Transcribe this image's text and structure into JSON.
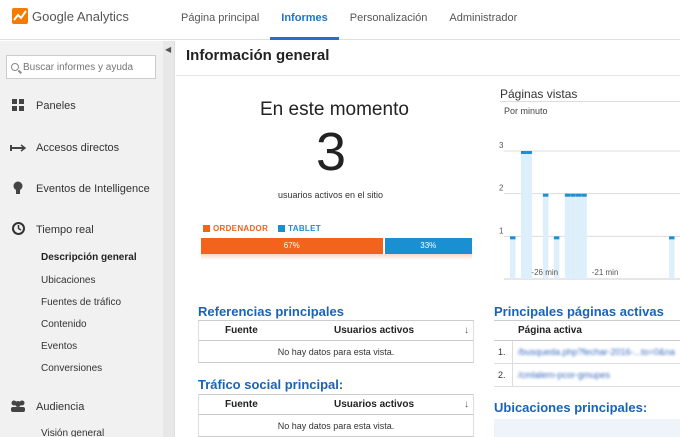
{
  "app": {
    "logo_text": "Google Analytics"
  },
  "topnav": {
    "items": [
      {
        "label": "Página principal"
      },
      {
        "label": "Informes"
      },
      {
        "label": "Personalización"
      },
      {
        "label": "Administrador"
      }
    ]
  },
  "sidebar": {
    "search_placeholder": "Buscar informes y ayuda",
    "items": [
      {
        "label": "Paneles",
        "icon": "grid-icon"
      },
      {
        "label": "Accesos directos",
        "icon": "shortcut-icon"
      },
      {
        "label": "Eventos de Intelligence",
        "icon": "lightbulb-icon"
      },
      {
        "label": "Tiempo real",
        "icon": "clock-icon"
      },
      {
        "label": "Audiencia",
        "icon": "people-icon"
      }
    ],
    "realtime_subitems": [
      {
        "label": "Descripción general"
      },
      {
        "label": "Ubicaciones"
      },
      {
        "label": "Fuentes de tráfico"
      },
      {
        "label": "Contenido"
      },
      {
        "label": "Eventos"
      },
      {
        "label": "Conversiones"
      }
    ],
    "audience_subitems": [
      {
        "label": "Visión general"
      }
    ]
  },
  "main": {
    "title": "Información general",
    "now": {
      "title": "En este momento",
      "count": "3",
      "subtitle": "usuarios activos en el sitio"
    },
    "devices": {
      "legend": [
        {
          "label": "ORDENADOR",
          "color": "#f2631c"
        },
        {
          "label": "TABLET",
          "color": "#1a8fd1"
        }
      ],
      "segments": [
        {
          "label": "67%",
          "value": 67,
          "color": "#f2631c"
        },
        {
          "label": "33%",
          "value": 33,
          "color": "#1a8fd1"
        }
      ]
    },
    "referrals": {
      "title": "Referencias principales",
      "col_source": "Fuente",
      "col_users": "Usuarios activos",
      "empty": "No hay datos para esta vista."
    },
    "social": {
      "title": "Tráfico social principal:",
      "col_source": "Fuente",
      "col_users": "Usuarios activos",
      "empty": "No hay datos para esta vista."
    },
    "top_pages": {
      "title": "Principales páginas activas",
      "col_page": "Página activa",
      "rows": [
        {
          "num": "1.",
          "url": "/busqueda.php?fechar-2016-...to=0&na"
        },
        {
          "num": "2.",
          "url": "/cmlalern-pcor-gmupes"
        }
      ]
    },
    "locations": {
      "title": "Ubicaciones principales:"
    }
  },
  "chart_data": {
    "type": "bar",
    "title": "Páginas vistas",
    "subtitle": "Por minuto",
    "ylim": [
      0,
      3
    ],
    "yticks": [
      "1",
      "2",
      "3"
    ],
    "xlabels": [
      "-26 min",
      "-21 min"
    ],
    "values": [
      1,
      0,
      3,
      3,
      0,
      0,
      2,
      0,
      1,
      0,
      2,
      2,
      2,
      2,
      0,
      0,
      0,
      0,
      0,
      0,
      0,
      0,
      0,
      0,
      0,
      0,
      0,
      0,
      0,
      1,
      0
    ],
    "color": "#1a8fd1"
  }
}
